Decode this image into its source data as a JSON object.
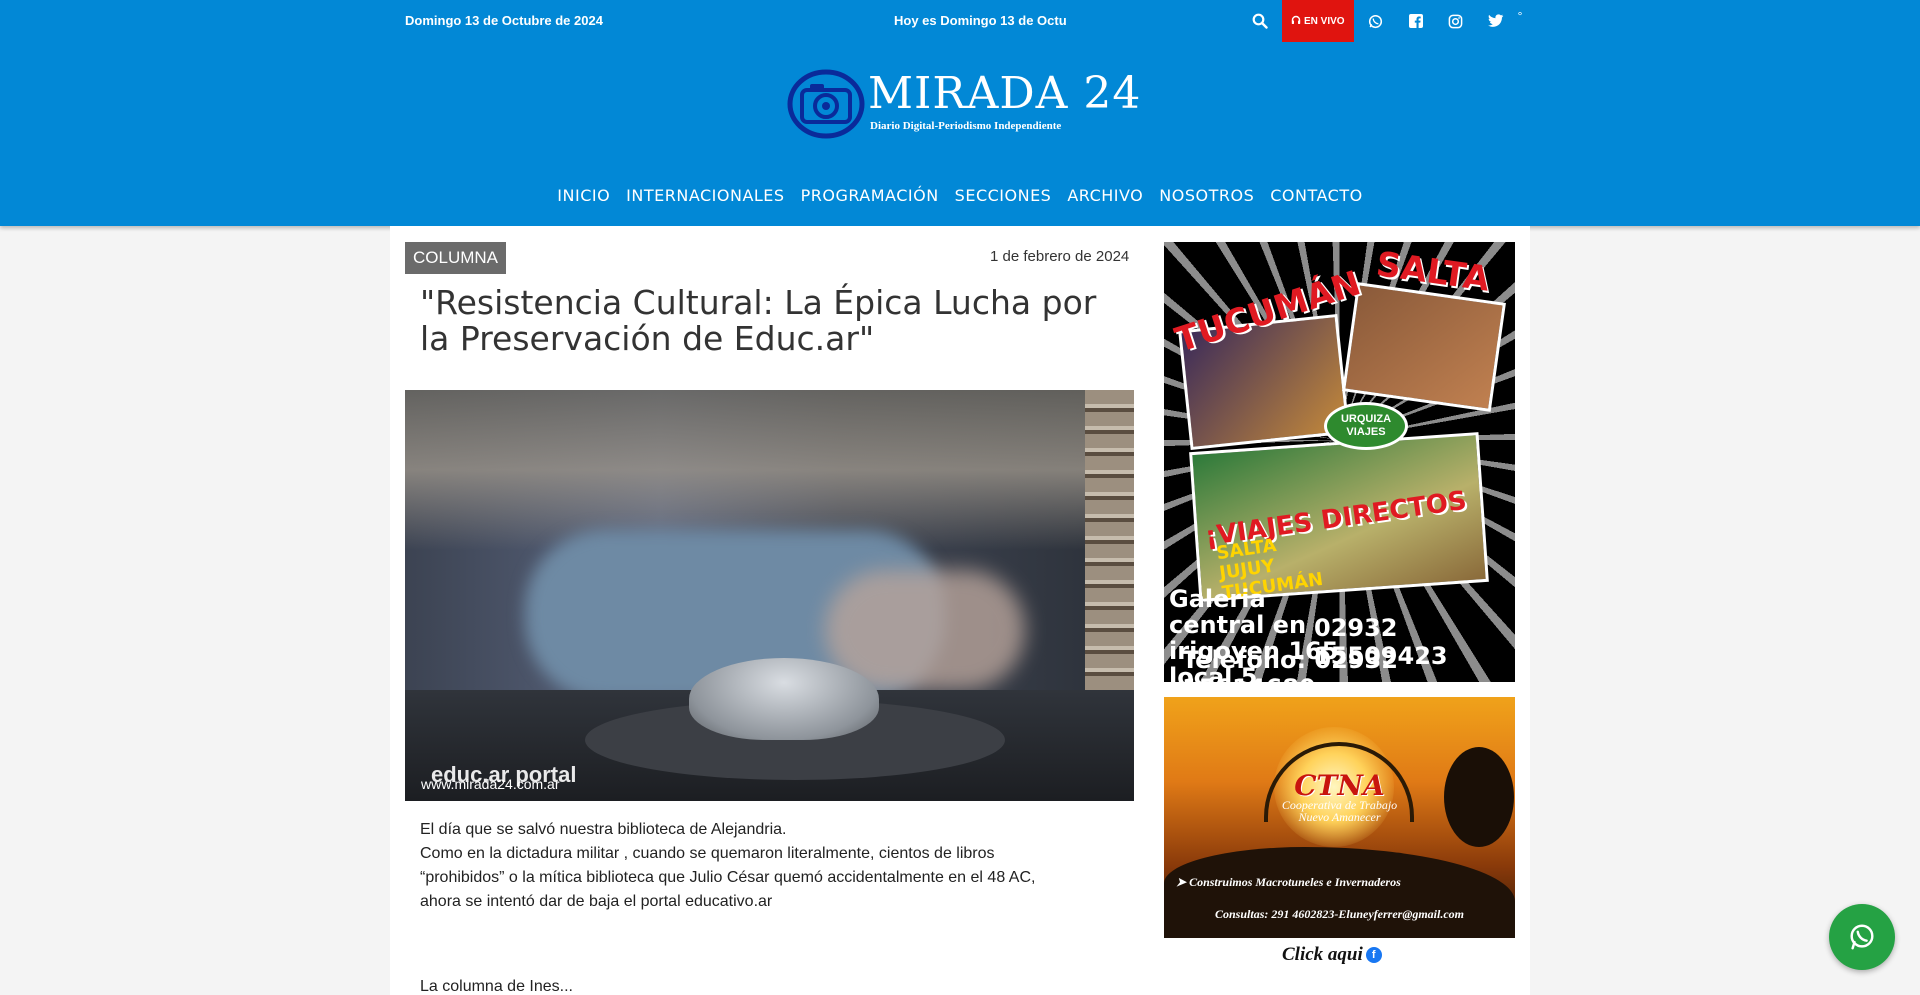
{
  "topbar": {
    "date_left": "Domingo 13 de Octubre de 2024",
    "date_center": "Hoy es Domingo 13 de Octu",
    "live_label": "EN VIVO",
    "degree": "°",
    "icons": [
      "search-icon",
      "headphones-icon",
      "whatsapp-icon",
      "facebook-icon",
      "instagram-icon",
      "twitter-icon"
    ]
  },
  "logo": {
    "title": "MIRADA 24",
    "subtitle": "Diario Digital-Periodismo Independiente"
  },
  "nav": {
    "items": [
      "INICIO",
      "INTERNACIONALES",
      "PROGRAMACIÓN",
      "SECCIONES",
      "ARCHIVO",
      "NOSOTROS",
      "CONTACTO"
    ]
  },
  "article": {
    "category": "COLUMNA",
    "date": "1 de febrero de 2024",
    "title": "\"Resistencia Cultural: La Épica Lucha por la Preservación de Educ.ar\"",
    "image_watermark_brand": "educ.ar portal",
    "image_watermark_url": "www.mirada24.com.ar",
    "paragraphs": [
      "El día que se salvó nuestra biblioteca de Alejandria.",
      "Como en la dictadura militar , cuando se quemaron literalmente, cientos de libros “prohibidos” o la mítica biblioteca que Julio César quemó accidentalmente en el 48 AC,",
      "ahora se intentó dar de baja el portal educativo.ar"
    ],
    "more": "La columna de Ines..."
  },
  "ads": {
    "ad1": {
      "title_left": "TUCUMÁN",
      "title_right": "SALTA",
      "badge": "URQUIZA VIAJES",
      "viajes": "¡VIAJES DIRECTOS",
      "destinations": [
        "SALTA",
        "JUJUY",
        "TUCUMÁN"
      ],
      "address": "Galeria central en irigoyen 165 local 5",
      "phone1": "02932 15509423",
      "phone2": "Telefono: 02932 15614680"
    },
    "ad2": {
      "brand": "CTNA",
      "coop_line1": "Cooperativa de Trabajo",
      "coop_line2": "Nuevo Amanecer",
      "tagline": "Construimos Macrotuneles e Invernaderos",
      "contact": "Consultas: 291 4602823-Eluneyferrer@gmail.com"
    },
    "click_label": "Click aqui"
  },
  "colors": {
    "header_blue": "#0288d6",
    "live_red": "#e0140f",
    "badge_gray": "#6b6b6b",
    "whatsapp_green": "#25a244"
  }
}
